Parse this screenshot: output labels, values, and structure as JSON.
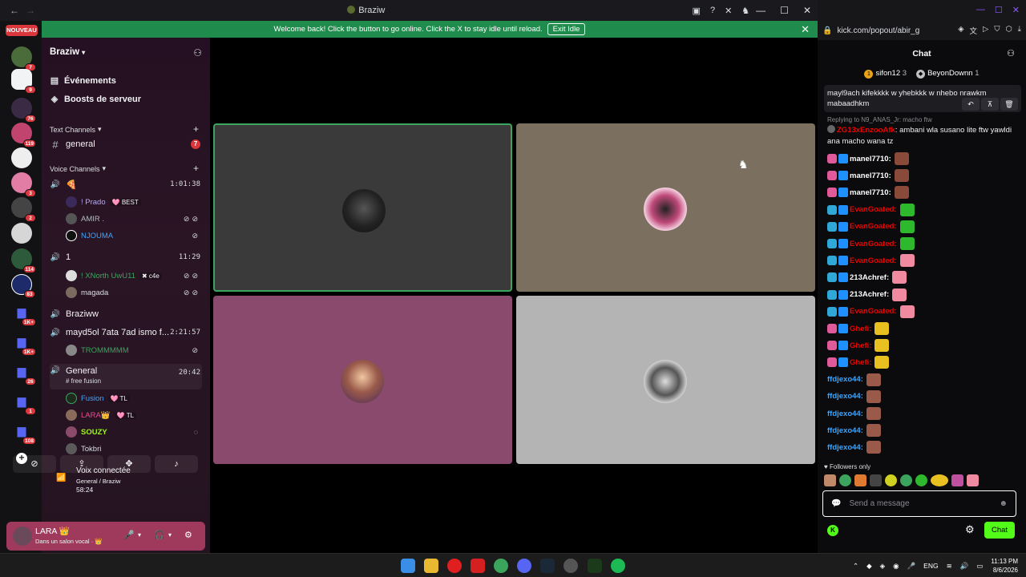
{
  "discord": {
    "window_title": "Braziw",
    "idle_banner": {
      "text": "Welcome back! Click the button to go online. Click the X to stay idle until reload.",
      "button": "Exit Idle",
      "close": "✕"
    },
    "new_badge": "NOUVEAU",
    "server_badges": [
      "7",
      "9",
      "76",
      "119",
      "3",
      "2",
      "114",
      "83",
      "1K+",
      "1K+",
      "26",
      "1",
      "108"
    ],
    "server_name": "Braziw",
    "events_label": "Événements",
    "boosts_label": "Boosts de serveur",
    "text_category": "Text Channels",
    "voice_category": "Voice Channels",
    "text_channel": {
      "name": "general",
      "unread": "7"
    },
    "voice_channels": [
      {
        "name": "🍕",
        "timer": "1:01:38",
        "users": [
          {
            "name": "! Prado",
            "tag": "🩷 BEST",
            "color": "#b5a9ff"
          },
          {
            "name": "AMIR .",
            "tag": "",
            "color": "#b5bac1"
          },
          {
            "name": "NJOUMA",
            "tag": "",
            "color": "#3ba5ff"
          }
        ]
      },
      {
        "name": "1",
        "timer": "11:29",
        "users": [
          {
            "name": "! XNorth UwU11",
            "tag": "✖ c4e",
            "color": "#3ba55d"
          },
          {
            "name": "magada",
            "tag": "",
            "color": "#dbdee1"
          }
        ]
      },
      {
        "name": "Braziww",
        "timer": "",
        "users": []
      },
      {
        "name": "mayd5ol 7ata 7ad ismo f...",
        "timer": "2:21:57",
        "users": [
          {
            "name": "TROMMMMM",
            "tag": "",
            "color": "#3ba55d"
          }
        ]
      },
      {
        "name": "General",
        "sub": "# free fusion",
        "timer": "20:42",
        "users": [
          {
            "name": "Fusion",
            "tag": "🩷 TL",
            "color": "#3ba5ff"
          },
          {
            "name": "LARA👑",
            "tag": "🩷 TL",
            "color": "#f04790"
          },
          {
            "name": "SOUZY",
            "tag": "",
            "color": "#9ef51c"
          },
          {
            "name": "Tokbri",
            "tag": "",
            "color": "#dbdee1"
          }
        ]
      }
    ],
    "voice_status": "Voix connectée",
    "voice_where": "General / Braziw",
    "voice_time": "58:24",
    "user_name": "LARA 👑",
    "user_status": "Dans un salon vocal · 👑"
  },
  "browser": {
    "url": "kick.com/popout/abir_g",
    "chat_title": "Chat",
    "leaders": [
      {
        "rank": "1",
        "name": "sifon12",
        "count": "3"
      },
      {
        "name": "BeyonDownn",
        "count": "1"
      }
    ],
    "pinned_text": "mayl9ach kifekkkk w yhebkkk w nhebo nrawkm mabaadhkm",
    "reply_label": "Replying to N9_ANAS_Jr: macho ftw",
    "reply_user": "ZG13xEnzooAfk",
    "reply_msg": "ambani wla susano lite ftw yawldi ana macho wana tz",
    "messages": [
      {
        "user": "manel7710:",
        "color": "#ffffff"
      },
      {
        "user": "manel7710:",
        "color": "#ffffff"
      },
      {
        "user": "manel7710:",
        "color": "#ffffff"
      },
      {
        "user": "EvanGoated:",
        "color": "#eb0400"
      },
      {
        "user": "EvanGoated:",
        "color": "#eb0400"
      },
      {
        "user": "EvanGoated:",
        "color": "#eb0400"
      },
      {
        "user": "EvanGoated:",
        "color": "#eb0400"
      },
      {
        "user": "213Achref:",
        "color": "#ffffff"
      },
      {
        "user": "213Achref:",
        "color": "#ffffff"
      },
      {
        "user": "EvanGoated:",
        "color": "#eb0400"
      },
      {
        "user": "Ghefi:",
        "color": "#eb0400"
      },
      {
        "user": "Ghefi:",
        "color": "#eb0400"
      },
      {
        "user": "Ghefi:",
        "color": "#eb0400"
      },
      {
        "user": "ffdjexo44:",
        "color": "#3ba5ff"
      },
      {
        "user": "ffdjexo44:",
        "color": "#3ba5ff"
      },
      {
        "user": "ffdjexo44:",
        "color": "#3ba5ff"
      },
      {
        "user": "ffdjexo44:",
        "color": "#3ba5ff"
      },
      {
        "user": "ffdjexo44:",
        "color": "#3ba5ff"
      }
    ],
    "followers_only": "Followers only",
    "input_placeholder": "Send a message",
    "send_button": "Chat"
  },
  "taskbar": {
    "lang": "ENG",
    "time": "11:13 PM",
    "date": "8/6/2026"
  }
}
